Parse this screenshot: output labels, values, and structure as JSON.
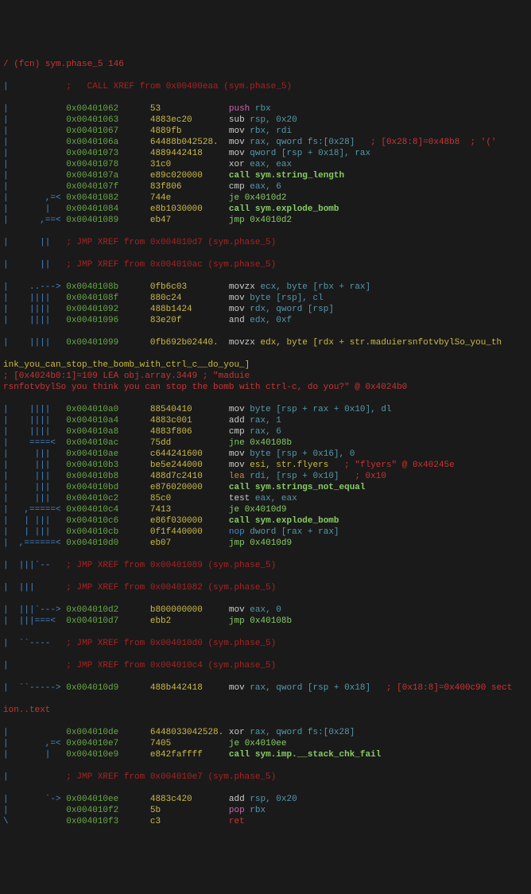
{
  "fn_header": "/ (fcn) sym.phase_5 146",
  "xref_top": ";   CALL XREF from 0x00400eaa (sym.phase_5)",
  "lines": [
    {
      "flow": "|           ",
      "addr": "0x00401062",
      "bytes": "53",
      "mnem": "push",
      "args": "rbx",
      "col_mnem": "magenta",
      "col_args": "cyan"
    },
    {
      "flow": "|           ",
      "addr": "0x00401063",
      "bytes": "4883ec20",
      "mnem": "sub",
      "args": "rsp, 0x20",
      "col_mnem": "white",
      "col_args": "cyan"
    },
    {
      "flow": "|           ",
      "addr": "0x00401067",
      "bytes": "4889fb",
      "mnem": "mov",
      "args": "rbx, rdi",
      "col_mnem": "white",
      "col_args": "cyan"
    },
    {
      "flow": "|           ",
      "addr": "0x0040106a",
      "bytes": "64488b042528.",
      "mnem": "mov",
      "args": "rax, qword fs:[0x28]",
      "col_mnem": "white",
      "col_args": "cyan",
      "cmt": "; [0x28:8]=0x48b8  ; '('"
    },
    {
      "flow": "|           ",
      "addr": "0x00401073",
      "bytes": "4889442418",
      "mnem": "mov",
      "args": "qword [rsp + 0x18], rax",
      "col_mnem": "white",
      "col_args": "cyan"
    },
    {
      "flow": "|           ",
      "addr": "0x00401078",
      "bytes": "31c0",
      "mnem": "xor",
      "args": "eax, eax",
      "col_mnem": "white",
      "col_args": "cyan"
    },
    {
      "flow": "|           ",
      "addr": "0x0040107a",
      "bytes": "e89c020000",
      "mnem": "call",
      "args": "sym.string_length",
      "col_mnem": "bgreen",
      "col_args": "bgreen",
      "bold": true
    },
    {
      "flow": "|           ",
      "addr": "0x0040107f",
      "bytes": "83f806",
      "mnem": "cmp",
      "args": "eax, 6",
      "col_mnem": "white",
      "col_args": "cyan"
    },
    {
      "flow": "|       ,=< ",
      "addr": "0x00401082",
      "bytes": "744e",
      "mnem": "je",
      "args": "0x4010d2",
      "col_mnem": "bgreen",
      "col_args": "bgreen"
    },
    {
      "flow": "|       |   ",
      "addr": "0x00401084",
      "bytes": "e8b1030000",
      "mnem": "call",
      "args": "sym.explode_bomb",
      "col_mnem": "bgreen",
      "col_args": "bgreen",
      "bold": true
    },
    {
      "flow": "|      ,==< ",
      "addr": "0x00401089",
      "bytes": "eb47",
      "mnem": "jmp",
      "args": "0x4010d2",
      "col_mnem": "bgreen",
      "col_args": "bgreen"
    }
  ],
  "xref1": "; JMP XREF from 0x004010d7 (sym.phase_5)",
  "xref2": "; JMP XREF from 0x004010ac (sym.phase_5)",
  "lines2": [
    {
      "flow": "|    ..---> ",
      "addr": "0x0040108b",
      "bytes": "0fb6c03",
      "mnem": "movzx",
      "args": "ecx, byte [rbx + rax]",
      "col_mnem": "white",
      "col_args": "cyan"
    },
    {
      "flow": "|    ||||   ",
      "addr": "0x0040108f",
      "bytes": "880c24",
      "mnem": "mov",
      "args": "byte [rsp], cl",
      "col_mnem": "white",
      "col_args": "cyan"
    },
    {
      "flow": "|    ||||   ",
      "addr": "0x00401092",
      "bytes": "488b1424",
      "mnem": "mov",
      "args": "rdx, qword [rsp]",
      "col_mnem": "white",
      "col_args": "cyan"
    },
    {
      "flow": "|    ||||   ",
      "addr": "0x00401096",
      "bytes": "83e20f",
      "mnem": "and",
      "args": "edx, 0xf",
      "col_mnem": "white",
      "col_args": "cyan"
    }
  ],
  "long_line": {
    "flow": "|    ||||   ",
    "addr": "0x00401099",
    "bytes": "0fb692b02440.",
    "mnem": "movzx",
    "args": "edx, byte [rdx + str.maduiersnfotvbylSo_you_th",
    "wrap1": "ink_you_can_stop_the_bomb_with_ctrl_c__do_you_]",
    "cmt": "; [0x4024b0:1]=109 LEA obj.array.3449 ; \"maduie",
    "wrap2": "rsnfotvbylSo you think you can stop the bomb with ctrl-c, do you?\" @ 0x4024b0"
  },
  "lines3": [
    {
      "flow": "|    ||||   ",
      "addr": "0x004010a0",
      "bytes": "88540410",
      "mnem": "mov",
      "args": "byte [rsp + rax + 0x10], dl",
      "col_mnem": "white",
      "col_args": "cyan"
    },
    {
      "flow": "|    ||||   ",
      "addr": "0x004010a4",
      "bytes": "4883c001",
      "mnem": "add",
      "args": "rax, 1",
      "col_mnem": "white",
      "col_args": "cyan"
    },
    {
      "flow": "|    ||||   ",
      "addr": "0x004010a8",
      "bytes": "4883f806",
      "mnem": "cmp",
      "args": "rax, 6",
      "col_mnem": "white",
      "col_args": "cyan"
    },
    {
      "flow": "|    ====<  ",
      "addr": "0x004010ac",
      "bytes": "75dd",
      "mnem": "jne",
      "args": "0x40108b",
      "col_mnem": "bgreen",
      "col_args": "bgreen"
    },
    {
      "flow": "|     |||   ",
      "addr": "0x004010ae",
      "bytes": "c644241600",
      "mnem": "mov",
      "args": "byte [rsp + 0x16], 0",
      "col_mnem": "white",
      "col_args": "cyan"
    },
    {
      "flow": "|     |||   ",
      "addr": "0x004010b3",
      "bytes": "be5e244000",
      "mnem": "mov",
      "args": "esi, str.flyers",
      "col_mnem": "white",
      "col_args": "yellow",
      "cmt": "; \"flyers\" @ 0x40245e"
    },
    {
      "flow": "|     |||   ",
      "addr": "0x004010b8",
      "bytes": "488d7c2410",
      "mnem": "lea",
      "args": "rdi, [rsp + 0x10]",
      "col_mnem": "orange",
      "col_args": "cyan",
      "cmt": "; 0x10"
    },
    {
      "flow": "|     |||   ",
      "addr": "0x004010bd",
      "bytes": "e876020000",
      "mnem": "call",
      "args": "sym.strings_not_equal",
      "col_mnem": "bgreen",
      "col_args": "bgreen",
      "bold": true
    },
    {
      "flow": "|     |||   ",
      "addr": "0x004010c2",
      "bytes": "85c0",
      "mnem": "test",
      "args": "eax, eax",
      "col_mnem": "white",
      "col_args": "cyan"
    },
    {
      "flow": "|   ,=====< ",
      "addr": "0x004010c4",
      "bytes": "7413",
      "mnem": "je",
      "args": "0x4010d9",
      "col_mnem": "bgreen",
      "col_args": "bgreen"
    },
    {
      "flow": "|   | |||   ",
      "addr": "0x004010c6",
      "bytes": "e86f030000",
      "mnem": "call",
      "args": "sym.explode_bomb",
      "col_mnem": "bgreen",
      "col_args": "bgreen",
      "bold": true
    },
    {
      "flow": "|   | |||   ",
      "addr": "0x004010cb",
      "bytes": "0f1f440000",
      "mnem": "nop",
      "args": "dword [rax + rax]",
      "col_mnem": "blue",
      "col_args": "cyan"
    },
    {
      "flow": "|  ,======< ",
      "addr": "0x004010d0",
      "bytes": "eb07",
      "mnem": "jmp",
      "args": "0x4010d9",
      "col_mnem": "bgreen",
      "col_args": "bgreen"
    }
  ],
  "xref3": "; JMP XREF from 0x00401089 (sym.phase_5)",
  "xref4": "; JMP XREF from 0x00401082 (sym.phase_5)",
  "lines4": [
    {
      "flow": "|  |||`---> ",
      "addr": "0x004010d2",
      "bytes": "b800000000",
      "mnem": "mov",
      "args": "eax, 0",
      "col_mnem": "white",
      "col_args": "cyan"
    },
    {
      "flow": "|  |||===<  ",
      "addr": "0x004010d7",
      "bytes": "ebb2",
      "mnem": "jmp",
      "args": "0x40108b",
      "col_mnem": "bgreen",
      "col_args": "bgreen"
    }
  ],
  "xref5": "; JMP XREF from 0x004010d0 (sym.phase_5)",
  "xref6": "; JMP XREF from 0x004010c4 (sym.phase_5)",
  "lines5": [
    {
      "flow": "|  ``-----> ",
      "addr": "0x004010d9",
      "bytes": "488b442418",
      "mnem": "mov",
      "args": "rax, qword [rsp + 0x18]",
      "col_mnem": "white",
      "col_args": "cyan",
      "cmt": "; [0x18:8]=0x400c90 sect"
    }
  ],
  "wrap_section": "ion..text",
  "lines6": [
    {
      "flow": "|           ",
      "addr": "0x004010de",
      "bytes": "6448033042528.",
      "mnem": "xor",
      "args": "rax, qword fs:[0x28]",
      "col_mnem": "white",
      "col_args": "cyan"
    },
    {
      "flow": "|       ,=< ",
      "addr": "0x004010e7",
      "bytes": "7405",
      "mnem": "je",
      "args": "0x4010ee",
      "col_mnem": "bgreen",
      "col_args": "bgreen"
    },
    {
      "flow": "|       |   ",
      "addr": "0x004010e9",
      "bytes": "e842faffff",
      "mnem": "call",
      "args": "sym.imp.__stack_chk_fail",
      "col_mnem": "bgreen",
      "col_args": "bgreen",
      "bold": true
    }
  ],
  "xref7": "; JMP XREF from 0x004010e7 (sym.phase_5)",
  "lines7": [
    {
      "flow": "|       `-> ",
      "addr": "0x004010ee",
      "bytes": "4883c420",
      "mnem": "add",
      "args": "rsp, 0x20",
      "col_mnem": "white",
      "col_args": "cyan"
    },
    {
      "flow": "|           ",
      "addr": "0x004010f2",
      "bytes": "5b",
      "mnem": "pop",
      "args": "rbx",
      "col_mnem": "magenta",
      "col_args": "cyan"
    },
    {
      "flow": "\\           ",
      "addr": "0x004010f3",
      "bytes": "c3",
      "mnem": "ret",
      "args": "",
      "col_mnem": "red",
      "col_args": ""
    }
  ]
}
